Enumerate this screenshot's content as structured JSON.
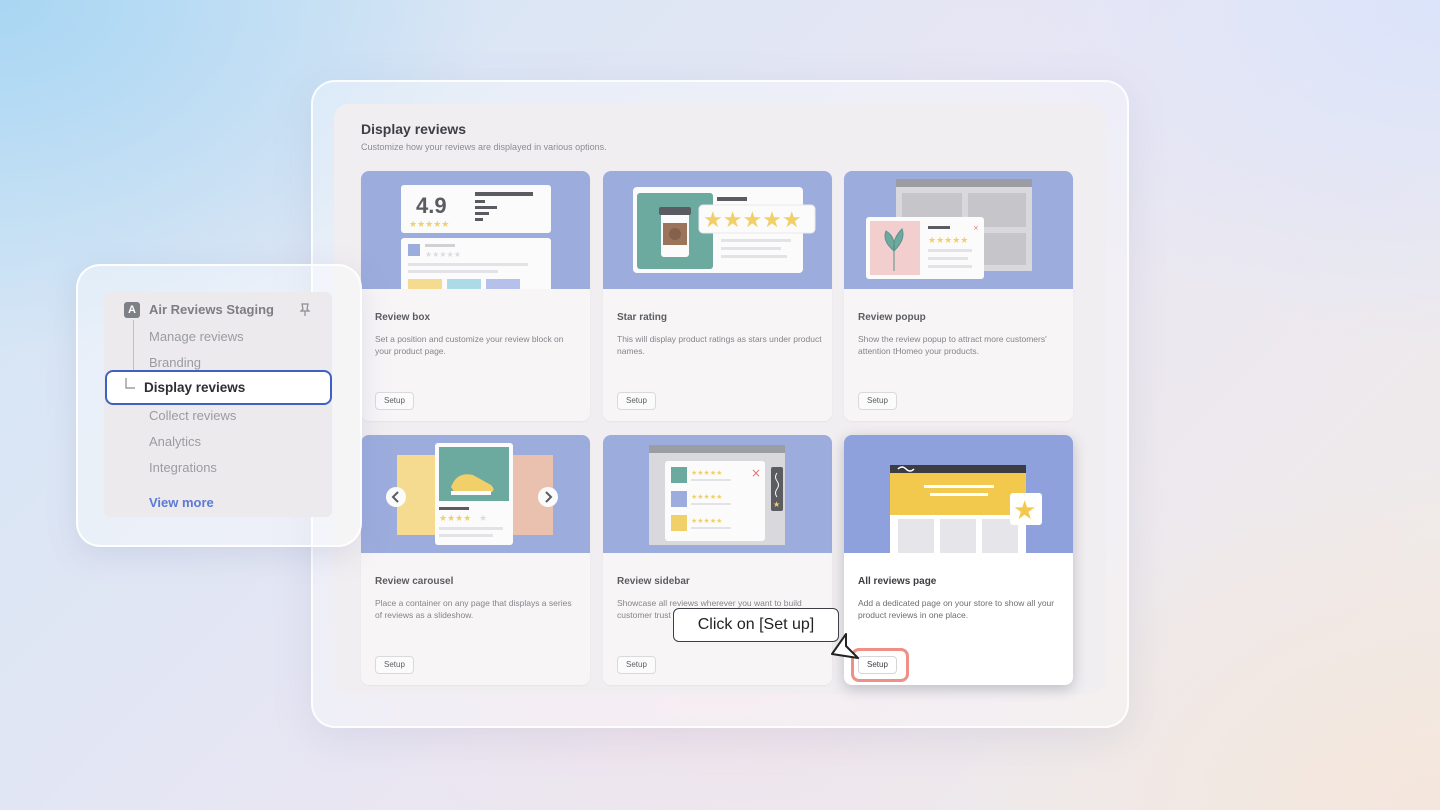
{
  "page": {
    "title": "Display reviews",
    "subtitle": "Customize how your reviews are displayed in various options."
  },
  "cards": [
    {
      "title": "Review box",
      "description": "Set a position and customize your review block on your product page.",
      "button": "Setup",
      "rating": "4.9"
    },
    {
      "title": "Star rating",
      "description": "This will display product ratings as stars under product names.",
      "button": "Setup"
    },
    {
      "title": "Review popup",
      "description": "Show the review popup to attract more customers' attention tHomeo your products.",
      "button": "Setup"
    },
    {
      "title": "Review carousel",
      "description": "Place a container on any page that displays a series of reviews as a slideshow.",
      "button": "Setup"
    },
    {
      "title": "Review sidebar",
      "description": "Showcase all reviews wherever you want to build customer trust",
      "button": "Setup"
    },
    {
      "title": "All reviews page",
      "description": "Add a dedicated page on your store to show all your product reviews in one place.",
      "button": "Setup"
    }
  ],
  "tooltip": {
    "text": "Click on [Set up]"
  },
  "sidebar": {
    "store_name": "Air Reviews Staging",
    "items": [
      "Manage reviews",
      "Branding",
      "Display reviews",
      "Collect reviews",
      "Analytics",
      "Integrations"
    ],
    "active_index": 2,
    "view_more": "View more"
  },
  "colors": {
    "accent": "#3f61c2",
    "card_art": "#8a9ed9",
    "star": "#f2c94c",
    "highlight": "#ef8f86",
    "link": "#5b7ad6"
  }
}
